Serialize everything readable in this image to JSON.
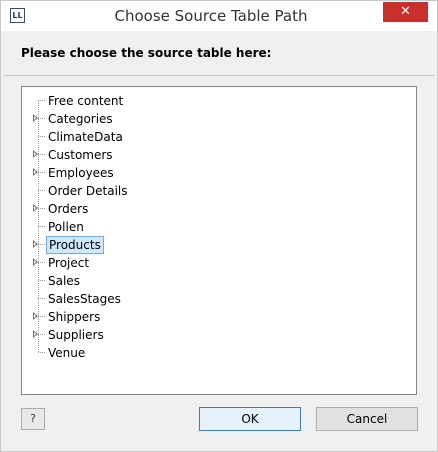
{
  "window": {
    "title": "Choose Source Table Path",
    "app_icon_text": "LL",
    "close_glyph": "✕"
  },
  "prompt": "Please choose the source table here:",
  "tree": {
    "items": [
      {
        "label": "Free content",
        "expandable": false,
        "selected": false
      },
      {
        "label": "Categories",
        "expandable": true,
        "selected": false
      },
      {
        "label": "ClimateData",
        "expandable": false,
        "selected": false
      },
      {
        "label": "Customers",
        "expandable": true,
        "selected": false
      },
      {
        "label": "Employees",
        "expandable": true,
        "selected": false
      },
      {
        "label": "Order Details",
        "expandable": false,
        "selected": false
      },
      {
        "label": "Orders",
        "expandable": true,
        "selected": false
      },
      {
        "label": "Pollen",
        "expandable": false,
        "selected": false
      },
      {
        "label": "Products",
        "expandable": true,
        "selected": true
      },
      {
        "label": "Project",
        "expandable": true,
        "selected": false
      },
      {
        "label": "Sales",
        "expandable": false,
        "selected": false
      },
      {
        "label": "SalesStages",
        "expandable": false,
        "selected": false
      },
      {
        "label": "Shippers",
        "expandable": true,
        "selected": false
      },
      {
        "label": "Suppliers",
        "expandable": true,
        "selected": false
      },
      {
        "label": "Venue",
        "expandable": false,
        "selected": false
      }
    ]
  },
  "buttons": {
    "help_glyph": "?",
    "ok_label": "OK",
    "cancel_label": "Cancel"
  },
  "colors": {
    "close_button": "#c7302c",
    "selection_fill": "#cce8ff",
    "selection_border": "#7aa7d6",
    "default_button_border": "#3c7fb1"
  }
}
